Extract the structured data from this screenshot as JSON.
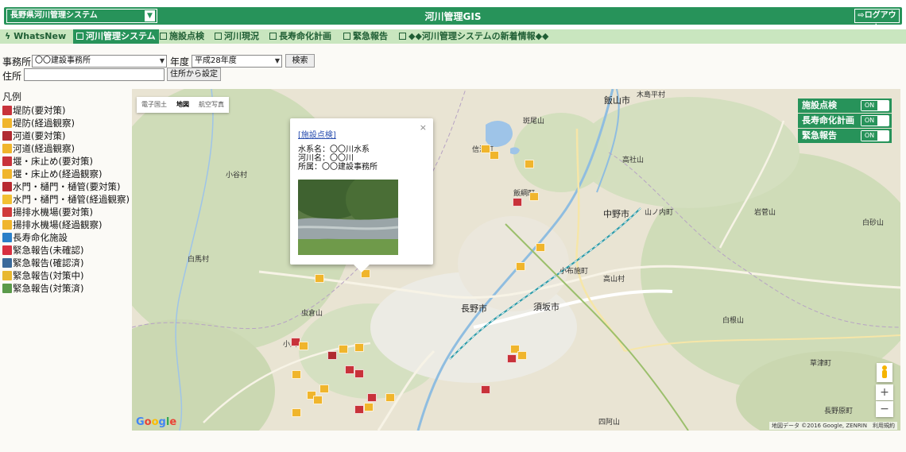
{
  "header": {
    "system_select": "長野県河川管理システム",
    "title": "河川管理GIS",
    "logout_label": "ログアウト"
  },
  "menu": {
    "items": [
      {
        "label": "WhatsNew"
      },
      {
        "label": "河川管理システム"
      },
      {
        "label": "施設点検"
      },
      {
        "label": "河川現況"
      },
      {
        "label": "長寿命化計画"
      },
      {
        "label": "緊急報告"
      },
      {
        "label": "◆◆河川管理システムの新着情報◆◆"
      }
    ]
  },
  "form": {
    "office_label": "事務所",
    "office_value": "〇〇建設事務所",
    "year_label": "年度",
    "year_value": "平成28年度",
    "search_label": "検索",
    "address_label": "住所",
    "address_value": "",
    "address_button": "住所から設定"
  },
  "legend": {
    "title": "凡例",
    "items": [
      {
        "label": "堤防(要対策)",
        "color": "#c8323a"
      },
      {
        "label": "堤防(経過観察)",
        "color": "#f0b52c"
      },
      {
        "label": "河道(要対策)",
        "color": "#b02a30"
      },
      {
        "label": "河道(経過観察)",
        "color": "#f0b52c"
      },
      {
        "label": "堰・床止め(要対策)",
        "color": "#c8323a"
      },
      {
        "label": "堰・床止め(経過観察)",
        "color": "#f0b52c"
      },
      {
        "label": "水門・樋門・樋管(要対策)",
        "color": "#b82a30"
      },
      {
        "label": "水門・樋門・樋管(経過観察)",
        "color": "#f2c032"
      },
      {
        "label": "揚排水機場(要対策)",
        "color": "#d03a3a"
      },
      {
        "label": "揚排水機場(経過観察)",
        "color": "#f0b52c"
      },
      {
        "label": "長寿命化施設",
        "color": "#2a7fc8"
      },
      {
        "label": "緊急報告(未確認)",
        "color": "#d83040"
      },
      {
        "label": "緊急報告(確認済)",
        "color": "#3a6a9a"
      },
      {
        "label": "緊急報告(対策中)",
        "color": "#e8b830"
      },
      {
        "label": "緊急報告(対策済)",
        "color": "#5a9a4a"
      }
    ]
  },
  "map": {
    "type_controls": [
      "電子国土",
      "地図",
      "航空写真"
    ],
    "active_type": "地図",
    "layers": [
      {
        "label": "施設点検",
        "state": "ON"
      },
      {
        "label": "長寿命化計画",
        "state": "ON"
      },
      {
        "label": "緊急報告",
        "state": "ON"
      }
    ],
    "popup": {
      "link": "[施設点検]",
      "close": "×",
      "lines": [
        "水系名：〇〇川水系",
        "河川名：〇〇川",
        "所属：〇〇建設事務所"
      ]
    },
    "places": [
      {
        "name": "飯山市"
      },
      {
        "name": "木島平村"
      },
      {
        "name": "斑尾山"
      },
      {
        "name": "信濃町"
      },
      {
        "name": "高社山"
      },
      {
        "name": "飯綱町"
      },
      {
        "name": "中野市"
      },
      {
        "name": "山ノ内町"
      },
      {
        "name": "岩菅山"
      },
      {
        "name": "白砂山"
      },
      {
        "name": "小谷村"
      },
      {
        "name": "白馬村"
      },
      {
        "name": "小布施町"
      },
      {
        "name": "高山村"
      },
      {
        "name": "長野市"
      },
      {
        "name": "須坂市"
      },
      {
        "name": "虫倉山"
      },
      {
        "name": "白根山"
      },
      {
        "name": "四阿山"
      },
      {
        "name": "長野原町"
      },
      {
        "name": "草津町"
      },
      {
        "name": "小川"
      }
    ],
    "zoom_in": "+",
    "zoom_out": "−",
    "google": "Google",
    "copyright": "地図データ ©2016 Google, ZENRIN　利用規約"
  }
}
